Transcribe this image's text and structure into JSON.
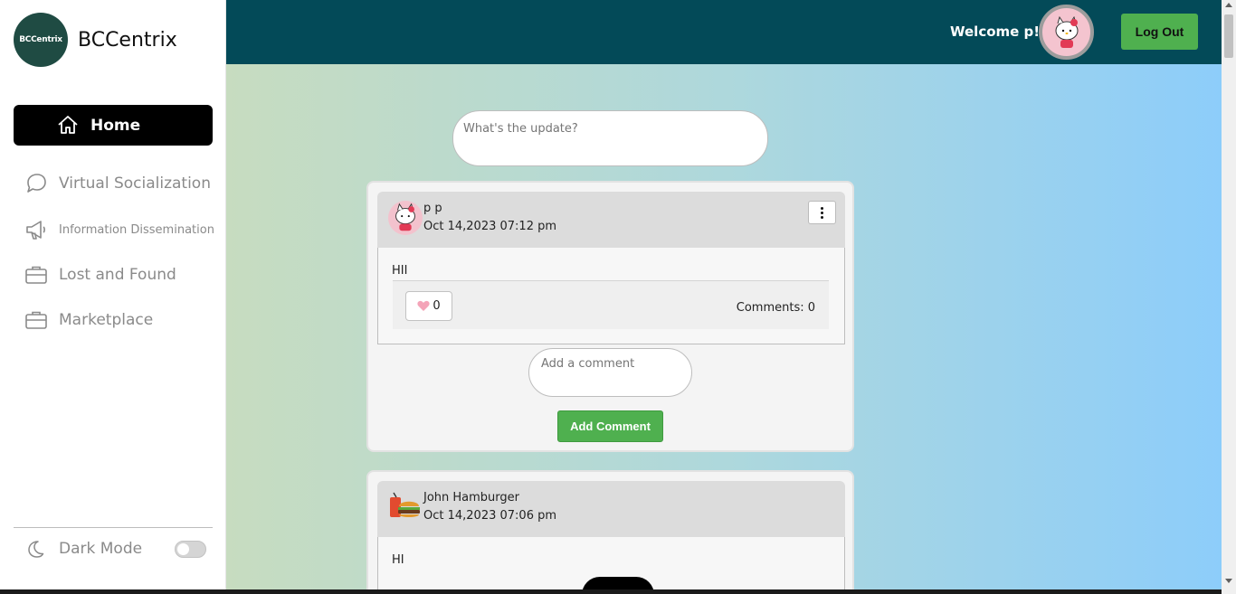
{
  "sidebar": {
    "brand_name": "BCCentrix",
    "logo_text": "BCCentrix",
    "items": [
      {
        "label": "Home",
        "icon": "home-icon",
        "active": true
      },
      {
        "label": "Virtual Socialization",
        "icon": "chat-icon"
      },
      {
        "label": "Information Dissemination",
        "icon": "megaphone-icon"
      },
      {
        "label": "Lost and Found",
        "icon": "briefcase-icon"
      },
      {
        "label": "Marketplace",
        "icon": "briefcase-icon"
      }
    ],
    "dark_mode_label": "Dark Mode",
    "dark_mode_on": false
  },
  "header": {
    "welcome": "Welcome p!",
    "logout_label": "Log Out"
  },
  "composer": {
    "placeholder": "What's the update?"
  },
  "posts": [
    {
      "author": "p p",
      "date": "Oct 14,2023 07:12 pm",
      "text": "HII",
      "likes": "0",
      "comments": "Comments: 0",
      "comment_placeholder": "Add a comment",
      "add_comment_label": "Add Comment"
    },
    {
      "author": "John Hamburger",
      "date": "Oct 14,2023 07:06 pm",
      "text": "HI"
    }
  ],
  "colors": {
    "header_bg": "#034a58",
    "accent_green": "#4fb04f",
    "active_nav": "#000000"
  }
}
